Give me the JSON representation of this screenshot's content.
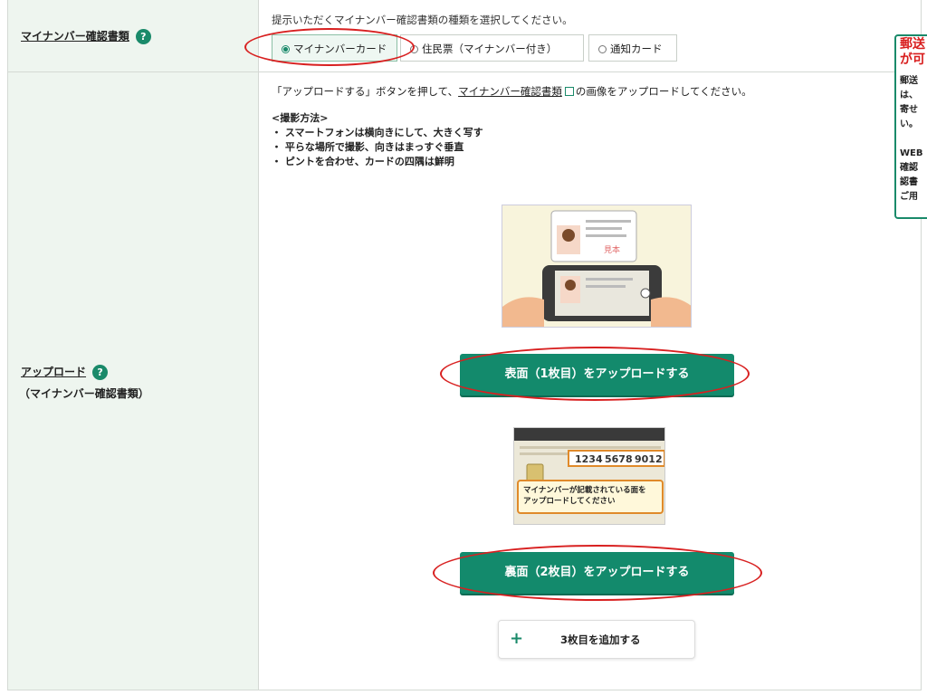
{
  "fields": {
    "docs": {
      "label": "マイナンバー確認書類",
      "prompt": "提示いただくマイナンバー確認書類の種類を選択してください。",
      "options": [
        {
          "label": "マイナンバーカード"
        },
        {
          "label": "住民票（マイナンバー付き）"
        },
        {
          "label": "通知カード"
        }
      ]
    },
    "upload": {
      "label": "アップロード",
      "sublabel": "（マイナンバー確認書類）",
      "intro_before": "「アップロードする」ボタンを押して、",
      "intro_link": "マイナンバー確認書類",
      "intro_after": "の画像をアップロードしてください。",
      "method_title": "<撮影方法>",
      "method_items": [
        "・ スマートフォンは横向きにして、大きく写す",
        "・ 平らな場所で撮影、向きはまっすぐ垂直",
        "・ ピントを合わせ、カードの四隅は鮮明"
      ],
      "front_button": "表面（1枚目）をアップロードする",
      "back_button": "裏面（2枚目）をアップロードする",
      "add_button": "3枚目を追加する",
      "add_plus": "+",
      "card_numbers": [
        "1234",
        "5678",
        "9012"
      ],
      "card_callout": "マイナンバーが記載されている面を\nアップロードしてください",
      "card_stamp": "見本"
    }
  },
  "help_glyph": "?",
  "side_panel": {
    "title": "郵送\nが可",
    "body": "郵送\nは、\n寄せ\nい。\n\nWEB\n確認\n認書\nご用"
  },
  "colors": {
    "accent": "#138a6c",
    "header_bg": "#eef5ef",
    "annotation": "#d82020",
    "side_title": "#d81c1c"
  }
}
